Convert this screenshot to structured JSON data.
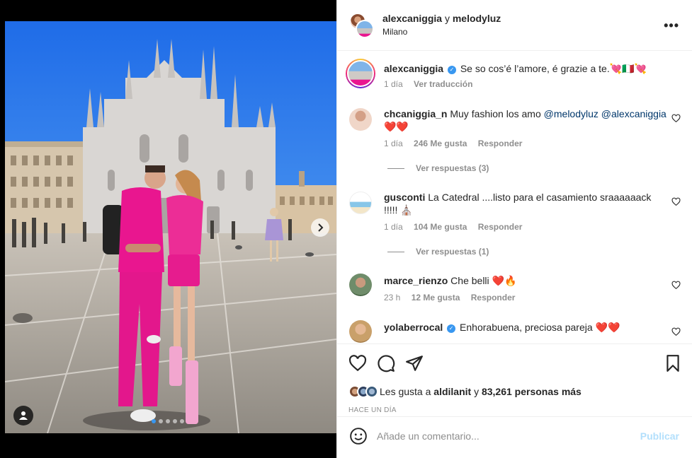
{
  "header": {
    "user1": "alexcaniggia",
    "separator": "y",
    "user2": "melodyluz",
    "location": "Milano",
    "more_icon": "more-horizontal-icon"
  },
  "caption": {
    "username": "alexcaniggia",
    "text": "Se so cos’é l’amore, é grazie a te.💘🇮🇹💘",
    "time": "1 día",
    "translate": "Ver traducción"
  },
  "comments": [
    {
      "username": "chcaniggia_n",
      "text": "Muy fashion los amo",
      "mentions": [
        "@melodyluz",
        "@alexcaniggia"
      ],
      "tail": "❤️❤️",
      "time": "1 día",
      "likes": "246 Me gusta",
      "reply": "Responder",
      "replies": "Ver respuestas (3)"
    },
    {
      "username": "gusconti",
      "text": "La Catedral ....listo para el casamiento sraaaaaack !!!!! ⛪",
      "time": "1 día",
      "likes": "104 Me gusta",
      "reply": "Responder",
      "replies": "Ver respuestas (1)"
    },
    {
      "username": "marce_rienzo",
      "text": "Che belli ❤️🔥",
      "time": "23 h",
      "likes": "12 Me gusta",
      "reply": "Responder"
    },
    {
      "username": "yolaberrocal",
      "text": "Enhorabuena, preciosa pareja ❤️❤️"
    }
  ],
  "likes": {
    "prefix": "Les gusta a",
    "user": "aldilanit",
    "joiner": "y",
    "others": "83,261 personas más"
  },
  "date": "HACE UN DÍA",
  "add_comment": {
    "placeholder": "Añade un comentario...",
    "publish": "Publicar"
  },
  "colors": {
    "accent": "#3897f0",
    "publish_disabled": "#b2dffc",
    "muted": "#8e8e8e",
    "mention": "#00376b",
    "pink": "#e9168f"
  }
}
